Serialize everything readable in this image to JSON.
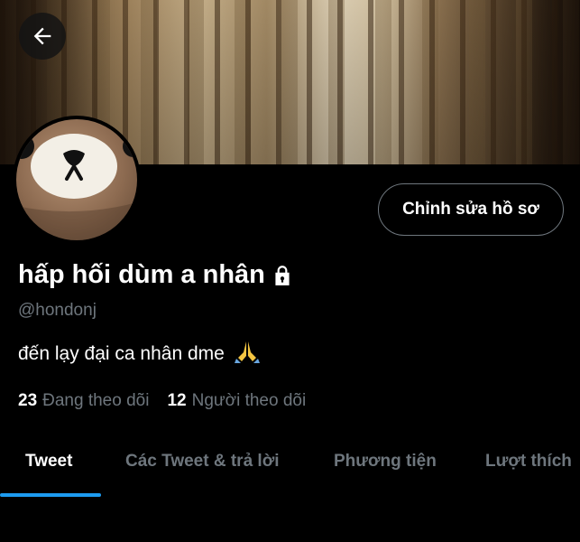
{
  "profile": {
    "name": "hấp hối dùm a nhân",
    "handle": "@hondonj",
    "bio": "đến lạy đại ca nhân dme",
    "following_count": "23",
    "following_label": "Đang theo dõi",
    "followers_count": "12",
    "followers_label": "Người theo dõi",
    "protected": true
  },
  "actions": {
    "edit_profile_label": "Chỉnh sửa hồ sơ"
  },
  "tabs": [
    {
      "label": "Tweet",
      "active": true
    },
    {
      "label": "Các Tweet & trả lời",
      "active": false
    },
    {
      "label": "Phương tiện",
      "active": false
    },
    {
      "label": "Lượt thích",
      "active": false
    }
  ],
  "icons": {
    "back": "arrow-left-icon",
    "lock": "lock-icon",
    "bio_emoji": "folded-hands-icon"
  },
  "colors": {
    "accent": "#1d9bf0",
    "muted": "#6e767d",
    "background": "#000000"
  }
}
